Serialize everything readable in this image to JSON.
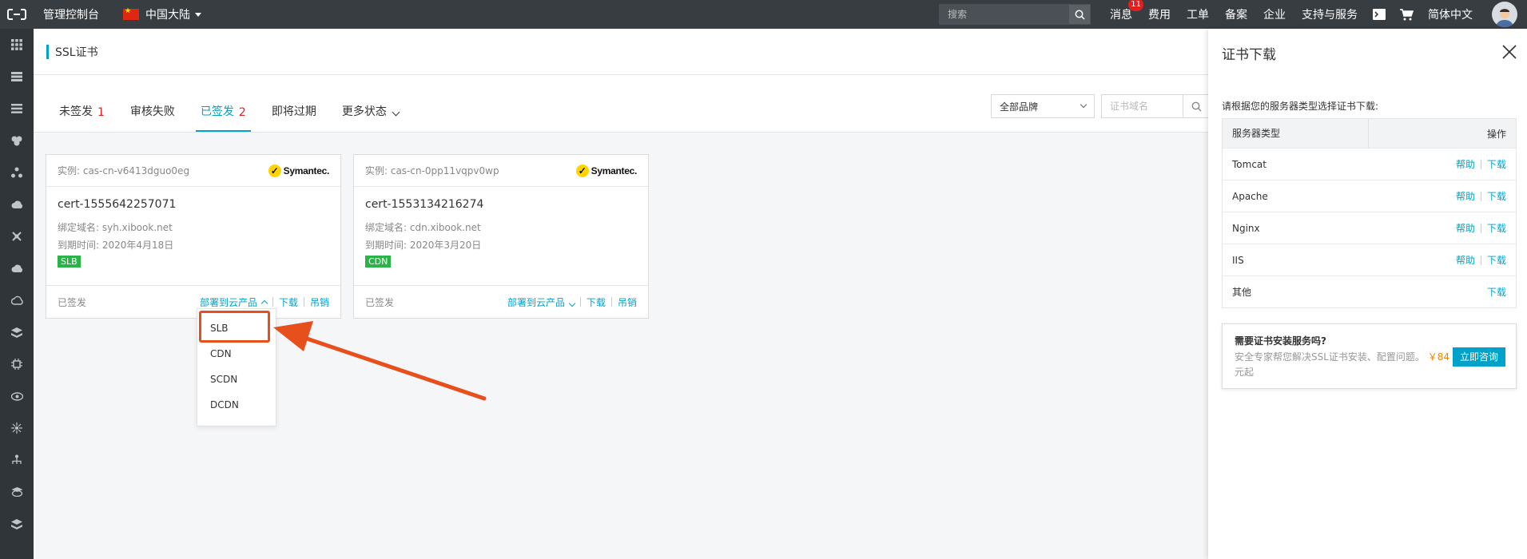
{
  "topbar": {
    "console_label": "管理控制台",
    "region_label": "中国大陆",
    "search_placeholder": "搜索",
    "nav": {
      "messages": "消息",
      "messages_badge": "11",
      "fees": "费用",
      "tickets": "工单",
      "icp": "备案",
      "enterprise": "企业",
      "support": "支持与服务",
      "language": "简体中文"
    }
  },
  "sidebar": {
    "icons": [
      "grid-icon",
      "server-stack-icon",
      "database-icon",
      "shield-group-icon",
      "network-icon",
      "cloud-upload-icon",
      "nodes-icon",
      "cloud-sync-icon",
      "cloud-storage-icon",
      "layers-icon",
      "chip-icon",
      "eye-icon",
      "hub-icon",
      "tree-icon",
      "layer-eye-icon",
      "stack-icon"
    ]
  },
  "page": {
    "title": "SSL证书"
  },
  "tabs": [
    {
      "label": "未签发",
      "count": "1"
    },
    {
      "label": "审核失败",
      "count": ""
    },
    {
      "label": "已签发",
      "count": "2"
    },
    {
      "label": "即将过期",
      "count": ""
    },
    {
      "label": "更多状态",
      "count": ""
    }
  ],
  "filters": {
    "brand_select": "全部品牌",
    "name_placeholder": "证书域名"
  },
  "cards": [
    {
      "instance": "实例: cas-cn-v6413dguo0eg",
      "brand": "Symantec.",
      "cert_name": "cert-1555642257071",
      "domain": "绑定域名:  syh.xibook.net",
      "expire": "到期时间:  2020年4月18日",
      "tag": "SLB",
      "status": "已签发",
      "deploy": "部署到云产品",
      "download": "下载",
      "revoke": "吊销"
    },
    {
      "instance": "实例: cas-cn-0pp11vqpv0wp",
      "brand": "Symantec.",
      "cert_name": "cert-1553134216274",
      "domain": "绑定域名:  cdn.xibook.net",
      "expire": "到期时间:  2020年3月20日",
      "tag": "CDN",
      "status": "已签发",
      "deploy": "部署到云产品",
      "download": "下载",
      "revoke": "吊销"
    }
  ],
  "dropdown": {
    "items": [
      "SLB",
      "CDN",
      "SCDN",
      "DCDN"
    ]
  },
  "panel": {
    "title": "证书下载",
    "instruction": "请根据您的服务器类型选择证书下载:",
    "col_type": "服务器类型",
    "col_action": "操作",
    "help": "帮助",
    "download": "下载",
    "rows": [
      "Tomcat",
      "Apache",
      "Nginx",
      "IIS",
      "其他"
    ],
    "promo": {
      "title": "需要证书安装服务吗?",
      "desc": "安全专家帮您解决SSL证书安装、配置问题。",
      "price": "￥84",
      "price_unit": "元起",
      "button": "立即咨询"
    }
  },
  "colors": {
    "topbar": "#373d41",
    "accent": "#00a2ca",
    "count_red": "#e02020",
    "tag_green": "#2bb34a",
    "highlight": "#e7501d"
  }
}
